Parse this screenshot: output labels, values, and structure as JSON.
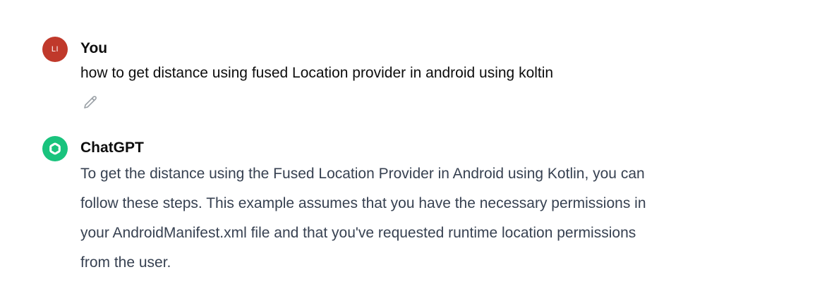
{
  "colors": {
    "user_avatar_bg": "#c0392b",
    "assistant_avatar_bg": "#19c37d",
    "author_text": "#0d0d0d",
    "reply_text": "#374151",
    "edit_icon": "#9aa0a6"
  },
  "user_message": {
    "avatar_initials": "LI",
    "author": "You",
    "text": "how to get distance using fused Location provider in android using koltin",
    "edit_icon": "pencil-icon"
  },
  "assistant_message": {
    "avatar_icon": "openai-logo-icon",
    "author": "ChatGPT",
    "lines": [
      "To get the distance using the Fused Location Provider in Android using Kotlin, you can",
      "follow these steps. This example assumes that you have the necessary permissions in",
      "your AndroidManifest.xml file and that you've requested runtime location permissions",
      "from the user."
    ]
  }
}
